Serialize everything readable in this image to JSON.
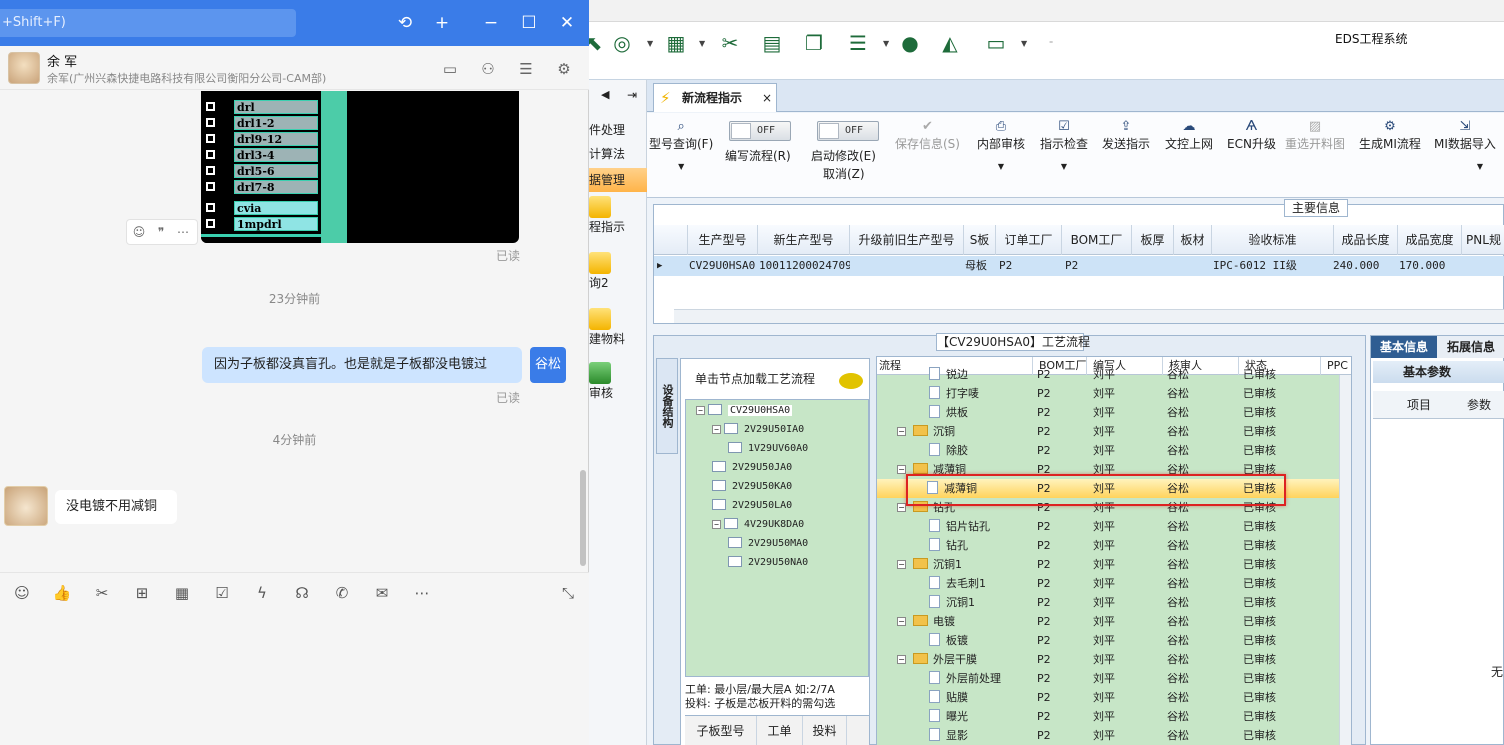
{
  "eds": {
    "app_title": "EDS工程系统",
    "nav_items": [
      "件处理",
      "计算法",
      "据管理"
    ],
    "nav_big": [
      "程指示",
      "询2",
      "建物料",
      "审核"
    ],
    "tab_label": "新流程指示",
    "ribbon": {
      "type_query": "型号查询(F)",
      "edit_flow": "编写流程(R)",
      "start_modify": "启动修改(E)",
      "cancel": "取消(Z)",
      "toggle_off": "OFF",
      "save_info": "保存信息(S)",
      "internal_review": "内部审核",
      "indicate_check": "指示检查",
      "send_indicate": "发送指示",
      "doc_upload": "文控上网",
      "ecn_upgrade": "ECN升级",
      "reselect_cut": "重选开料图",
      "gen_mi": "生成MI流程",
      "mi_import": "MI数据导入"
    },
    "info": {
      "title": "主要信息",
      "columns": [
        "生产型号",
        "新生产型号",
        "升级前旧生产型号",
        "S板",
        "订单工厂",
        "BOM工厂",
        "板厚",
        "板材",
        "验收标准",
        "成品长度",
        "成品宽度",
        "PNL规"
      ],
      "row": [
        "CV29U0HSA0",
        "10011200024709",
        "",
        "母板",
        "P2",
        "P2",
        "",
        "",
        "IPC-6012 II级",
        "240.000",
        "170.000",
        ""
      ]
    },
    "process": {
      "title": "【CV29U0HSA0】工艺流程",
      "vtab": "设备结构",
      "tree_header": "单击节点加载工艺流程",
      "tree": [
        {
          "label": "CV29U0HSA0",
          "level": 0,
          "pm": "−"
        },
        {
          "label": "2V29U50IA0",
          "level": 1,
          "pm": "−"
        },
        {
          "label": "1V29UV60A0",
          "level": 2,
          "pm": ""
        },
        {
          "label": "2V29U50JA0",
          "level": 1,
          "pm": ""
        },
        {
          "label": "2V29U50KA0",
          "level": 1,
          "pm": ""
        },
        {
          "label": "2V29U50LA0",
          "level": 1,
          "pm": ""
        },
        {
          "label": "4V29UK8DA0",
          "level": 1,
          "pm": "−"
        },
        {
          "label": "2V29U50MA0",
          "level": 2,
          "pm": ""
        },
        {
          "label": "2V29U50NA0",
          "level": 2,
          "pm": ""
        }
      ],
      "note1": "工单: 最小层/最大层A 如:2/7A",
      "note2": "投料: 子板是芯板开料的需勾选",
      "tree_tabs": [
        "子板型号",
        "工单",
        "投料"
      ],
      "flow_columns": [
        "流程",
        "BOM工厂",
        "编写人",
        "核审人",
        "状态",
        "PPC"
      ],
      "flow_rows": [
        {
          "name": "锐边",
          "type": "item",
          "bom": "P2",
          "writer": "刘平",
          "reviewer": "谷松",
          "status": "已审核"
        },
        {
          "name": "打字唛",
          "type": "item",
          "bom": "P2",
          "writer": "刘平",
          "reviewer": "谷松",
          "status": "已审核"
        },
        {
          "name": "烘板",
          "type": "item",
          "bom": "P2",
          "writer": "刘平",
          "reviewer": "谷松",
          "status": "已审核"
        },
        {
          "name": "沉铜",
          "type": "folder",
          "bom": "P2",
          "writer": "刘平",
          "reviewer": "谷松",
          "status": "已审核"
        },
        {
          "name": "除胶",
          "type": "item",
          "bom": "P2",
          "writer": "刘平",
          "reviewer": "谷松",
          "status": "已审核"
        },
        {
          "name": "减薄铜",
          "type": "folder",
          "bom": "P2",
          "writer": "刘平",
          "reviewer": "谷松",
          "status": "已审核"
        },
        {
          "name": "减薄铜",
          "type": "item",
          "bom": "P2",
          "writer": "刘平",
          "reviewer": "谷松",
          "status": "已审核",
          "selected": true
        },
        {
          "name": "钻孔",
          "type": "folder",
          "bom": "P2",
          "writer": "刘平",
          "reviewer": "谷松",
          "status": "已审核"
        },
        {
          "name": "铝片钻孔",
          "type": "item",
          "bom": "P2",
          "writer": "刘平",
          "reviewer": "谷松",
          "status": "已审核"
        },
        {
          "name": "钻孔",
          "type": "item",
          "bom": "P2",
          "writer": "刘平",
          "reviewer": "谷松",
          "status": "已审核"
        },
        {
          "name": "沉铜1",
          "type": "folder",
          "bom": "P2",
          "writer": "刘平",
          "reviewer": "谷松",
          "status": "已审核"
        },
        {
          "name": "去毛刺1",
          "type": "item",
          "bom": "P2",
          "writer": "刘平",
          "reviewer": "谷松",
          "status": "已审核"
        },
        {
          "name": "沉铜1",
          "type": "item",
          "bom": "P2",
          "writer": "刘平",
          "reviewer": "谷松",
          "status": "已审核"
        },
        {
          "name": "电镀",
          "type": "folder",
          "bom": "P2",
          "writer": "刘平",
          "reviewer": "谷松",
          "status": "已审核"
        },
        {
          "name": "板镀",
          "type": "item",
          "bom": "P2",
          "writer": "刘平",
          "reviewer": "谷松",
          "status": "已审核"
        },
        {
          "name": "外层干膜",
          "type": "folder",
          "bom": "P2",
          "writer": "刘平",
          "reviewer": "谷松",
          "status": "已审核"
        },
        {
          "name": "外层前处理",
          "type": "item",
          "bom": "P2",
          "writer": "刘平",
          "reviewer": "谷松",
          "status": "已审核"
        },
        {
          "name": "贴膜",
          "type": "item",
          "bom": "P2",
          "writer": "刘平",
          "reviewer": "谷松",
          "status": "已审核"
        },
        {
          "name": "曝光",
          "type": "item",
          "bom": "P2",
          "writer": "刘平",
          "reviewer": "谷松",
          "status": "已审核"
        },
        {
          "name": "显影",
          "type": "item",
          "bom": "P2",
          "writer": "刘平",
          "reviewer": "谷松",
          "status": "已审核"
        }
      ]
    },
    "right_panel": {
      "tab_basic": "基本信息",
      "tab_ext": "拓展信息",
      "sub": "基本参数",
      "col_item": "项目",
      "col_param": "参数",
      "empty": "无"
    }
  },
  "chat": {
    "search_placeholder": "+Shift+F)",
    "contact_name": "余 军",
    "contact_org": "余军(广州兴森快捷电路科技有限公司衡阳分公司-CAM部)",
    "cam_items": [
      {
        "label": "drl",
        "style": "grey"
      },
      {
        "label": "drl1-2",
        "style": "grey"
      },
      {
        "label": "drl9-12",
        "style": "grey"
      },
      {
        "label": "drl3-4",
        "style": "grey"
      },
      {
        "label": "drl5-6",
        "style": "grey"
      },
      {
        "label": "drl7-8",
        "style": "grey"
      },
      {
        "label": "cvia",
        "style": "cyan"
      },
      {
        "label": "1mpdrl",
        "style": "cyan"
      }
    ],
    "read1": "已读",
    "time1": "23分钟前",
    "out_msg": "因为子板都没真盲孔。也是就是子板都没电镀过",
    "out_avatar": "谷松",
    "read2": "已读",
    "time2": "4分钟前",
    "in_msg": "没电镀不用减铜"
  }
}
